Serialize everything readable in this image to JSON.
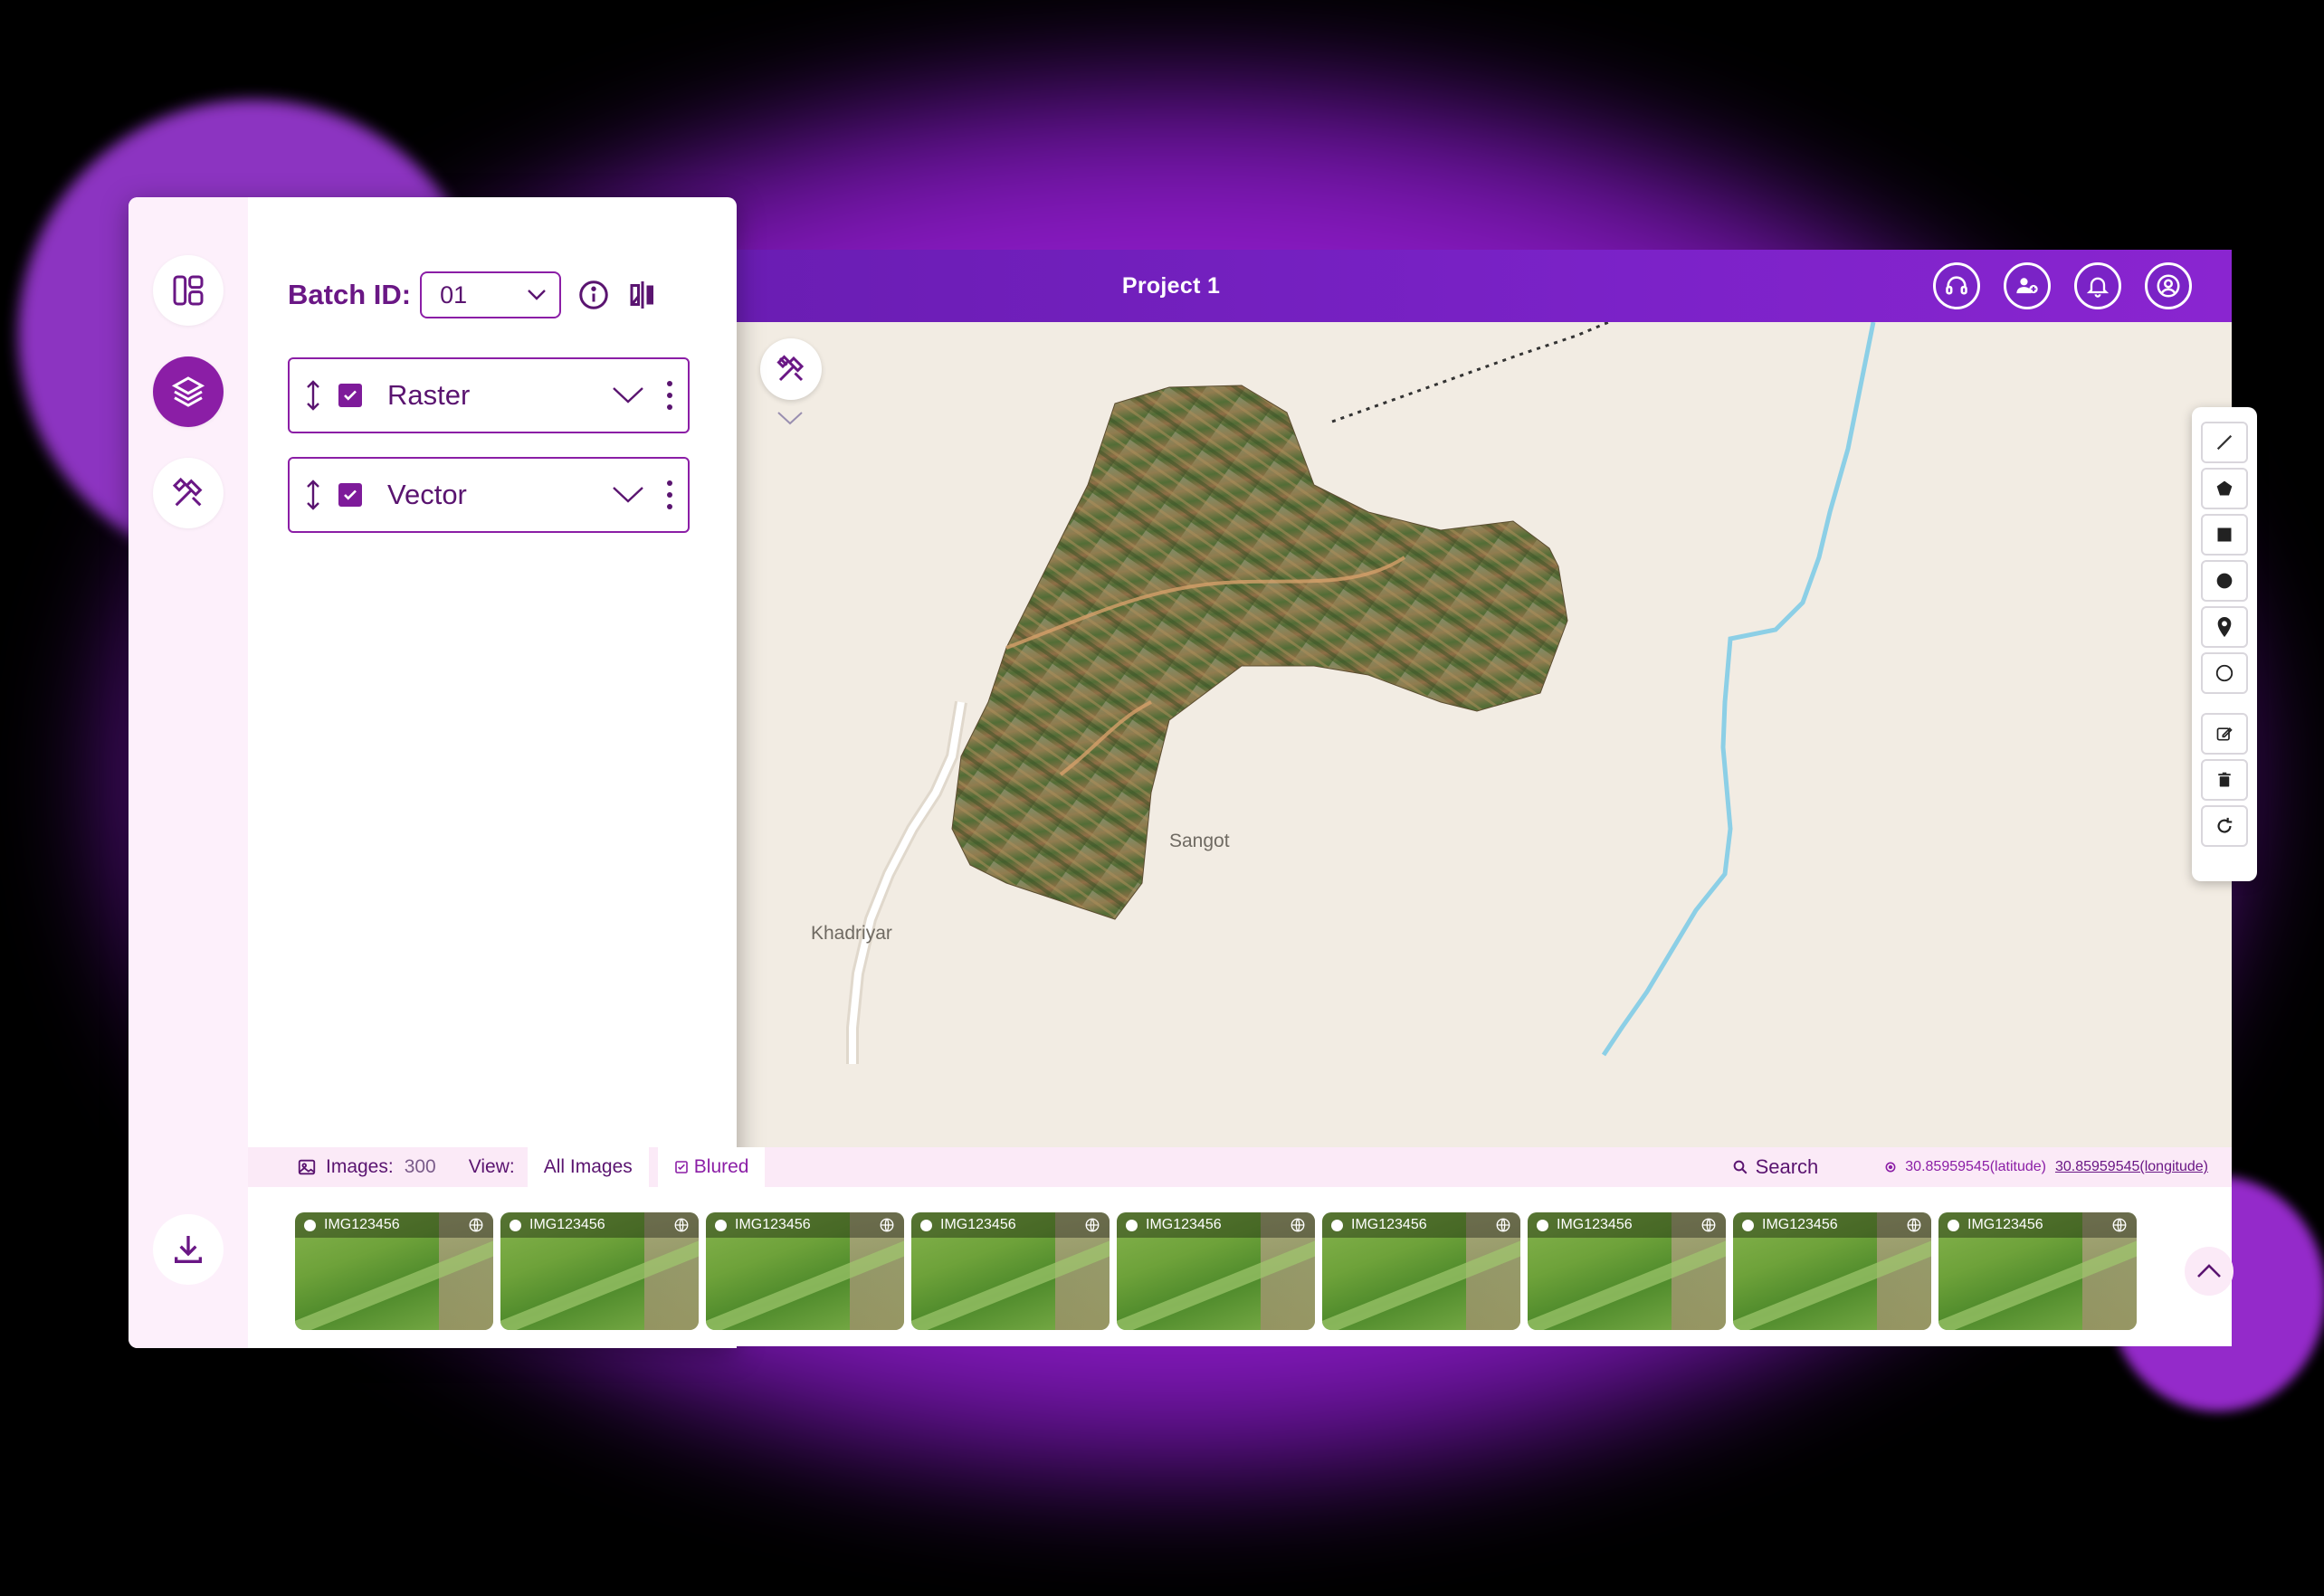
{
  "project": {
    "title": "Project 1"
  },
  "top_icons": [
    "headset-icon",
    "add-user-icon",
    "bell-icon",
    "user-icon"
  ],
  "rail": {
    "items": [
      "layout-icon",
      "layers-icon",
      "tools-icon"
    ],
    "download": "download-icon"
  },
  "batch": {
    "label": "Batch ID:",
    "value": "01"
  },
  "layers": [
    {
      "name": "Raster",
      "checked": true
    },
    {
      "name": "Vector",
      "checked": true
    }
  ],
  "map": {
    "labels": {
      "place1": "Sangot",
      "place2": "Khadriyar"
    }
  },
  "draw_tools": [
    "line-icon",
    "polygon-icon",
    "square-icon",
    "circle-filled-icon",
    "marker-icon",
    "circle-outline-icon",
    "edit-icon",
    "trash-icon",
    "rotate-icon"
  ],
  "images_bar": {
    "images_label": "Images:",
    "images_count": "300",
    "view_label": "View:",
    "tab_all": "All Images",
    "tab_blurred": "Blured",
    "search_label": "Search",
    "latitude": "30.85959545(latitude)",
    "longitude": "30.85959545(longitude)"
  },
  "thumbnails": [
    {
      "name": "IMG123456"
    },
    {
      "name": "IMG123456"
    },
    {
      "name": "IMG123456"
    },
    {
      "name": "IMG123456"
    },
    {
      "name": "IMG123456"
    },
    {
      "name": "IMG123456"
    },
    {
      "name": "IMG123456"
    },
    {
      "name": "IMG123456"
    },
    {
      "name": "IMG123456"
    }
  ],
  "colors": {
    "brand": "#8b1ea6",
    "topbar": "#7b22c8",
    "river": "#8ccfe6"
  }
}
